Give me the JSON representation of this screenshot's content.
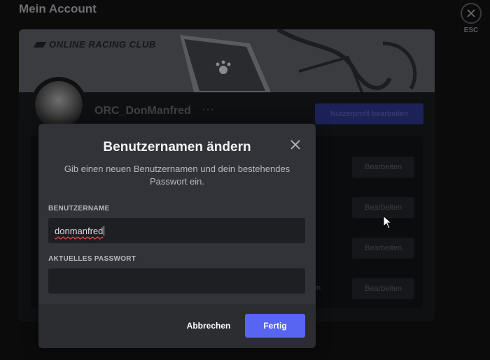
{
  "page": {
    "title": "Mein Account",
    "esc_label": "ESC"
  },
  "profile": {
    "banner_logo": "ONLINE RACING CLUB",
    "display_name": "ORC_DonManfred",
    "more_icon": "ellipsis-icon",
    "edit_profile_label": "Nutzerprofil bearbeiten",
    "edit_buttons": [
      "Bearbeiten",
      "Bearbeiten",
      "Bearbeiten",
      "Bearbeiten"
    ],
    "row_partial_text": "ernen"
  },
  "modal": {
    "title": "Benutzernamen ändern",
    "subtitle": "Gib einen neuen Benutzernamen und dein bestehendes Passwort ein.",
    "username_label": "BENUTZERNAME",
    "username_value": "donmanfred",
    "password_label": "AKTUELLES PASSWORT",
    "password_value": "",
    "cancel_label": "Abbrechen",
    "done_label": "Fertig",
    "close_icon": "close-icon"
  },
  "colors": {
    "accent": "#5865f2",
    "modal_bg": "#313338",
    "input_bg": "#1e1f22",
    "footer_bg": "#2b2d31"
  }
}
